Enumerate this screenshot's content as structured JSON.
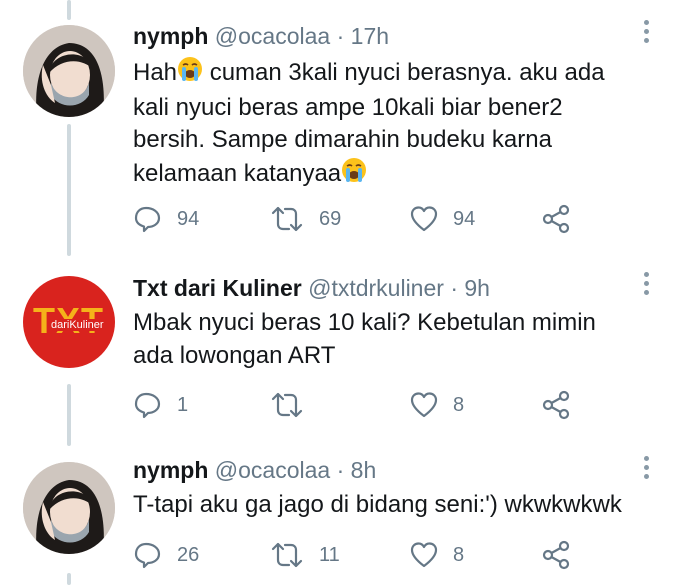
{
  "tweets": [
    {
      "name": "nymph",
      "handle": "@ocacolaa",
      "time": "17h",
      "avatar": "profile-photo",
      "text_parts": [
        "Hah",
        " cuman 3kali nyuci berasnya. aku ada\nkali nyuci beras ampe 10kali biar bener2\nbersih. Sampe dimarahin budeku karna\nkelamaan katanyaa",
        ""
      ],
      "emoji": "loudly-crying-face",
      "replies": "94",
      "retweets": "69",
      "likes": "94"
    },
    {
      "name": "Txt dari Kuliner",
      "handle": "@txtdrkuliner",
      "time": "9h",
      "avatar_logo_big": "TXT",
      "avatar_logo_small": "dariKuliner",
      "text": "Mbak nyuci beras 10 kali? Kebetulan mimin\nada lowongan ART",
      "replies": "1",
      "retweets": "",
      "likes": "8"
    },
    {
      "name": "nymph",
      "handle": "@ocacolaa",
      "time": "8h",
      "avatar": "profile-photo",
      "text": "T-tapi aku ga jago di bidang seni:') wkwkwkwk",
      "replies": "26",
      "retweets": "11",
      "likes": "8"
    }
  ],
  "separator": " · ",
  "colors": {
    "text": "#14171a",
    "secondary": "#657786",
    "thread_line": "#cfd9de",
    "logo_bg": "#d9231e",
    "logo_text": "#f5b21a"
  }
}
